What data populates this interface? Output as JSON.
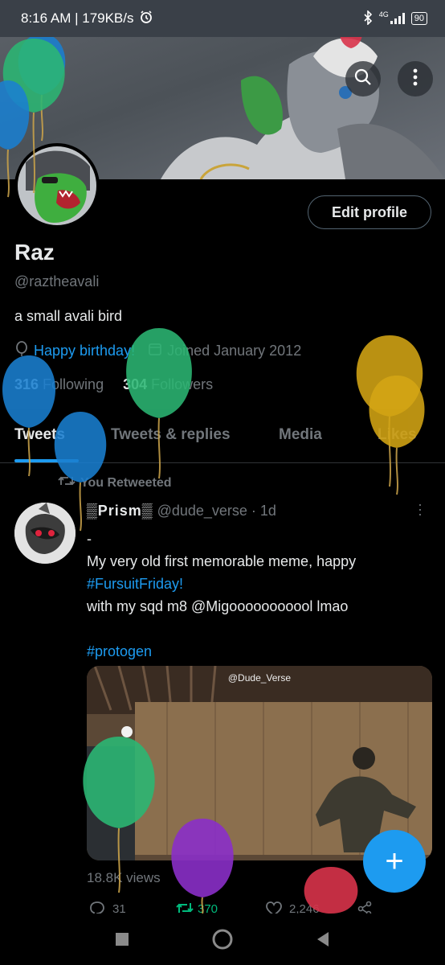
{
  "status_bar": {
    "time_text": "8:16 AM | 179KB/s",
    "network": "4G",
    "battery": "90",
    "icons": [
      "alarm-icon",
      "bluetooth-icon",
      "signal-icon",
      "battery-icon"
    ]
  },
  "header_actions": {
    "search_icon": "search-icon",
    "more_icon": "more-vertical-icon"
  },
  "profile": {
    "edit_label": "Edit profile",
    "name": "Raz",
    "handle": "@raztheavali",
    "bio": "a small avali bird",
    "birthday_text": "Happy birthday!",
    "joined_text": "Joined January 2012",
    "following_count": "316",
    "following_label": "Following",
    "followers_count": "304",
    "followers_label": "Followers"
  },
  "tabs": [
    {
      "label": "Tweets",
      "active": true
    },
    {
      "label": "Tweets & replies",
      "active": false
    },
    {
      "label": "Media",
      "active": false
    },
    {
      "label": "Likes",
      "active": false
    }
  ],
  "tweet": {
    "retweet_label": "You Retweeted",
    "display_name": "▒Prism▒",
    "username_time": "@dude_verse · 1d",
    "lines": [
      "-",
      "My very old first memorable meme, happy",
      "#FursuitFriday!",
      "with my sqd m8 @Migooooooooool lmao",
      "",
      "#protogen"
    ],
    "media_watermark": "@Dude_Verse",
    "views": "18.8K views",
    "replies": "31",
    "retweets": "370",
    "likes": "2,246"
  },
  "fab_label": "+",
  "colors": {
    "accent": "#1d9bf0",
    "background": "#000000",
    "secondary_text": "#71767b",
    "balloon_green": "#2bb673",
    "balloon_blue": "#1a7fd0",
    "balloon_gold": "#d4a514",
    "balloon_purple": "#8a2fc8",
    "balloon_red": "#d8334a"
  }
}
